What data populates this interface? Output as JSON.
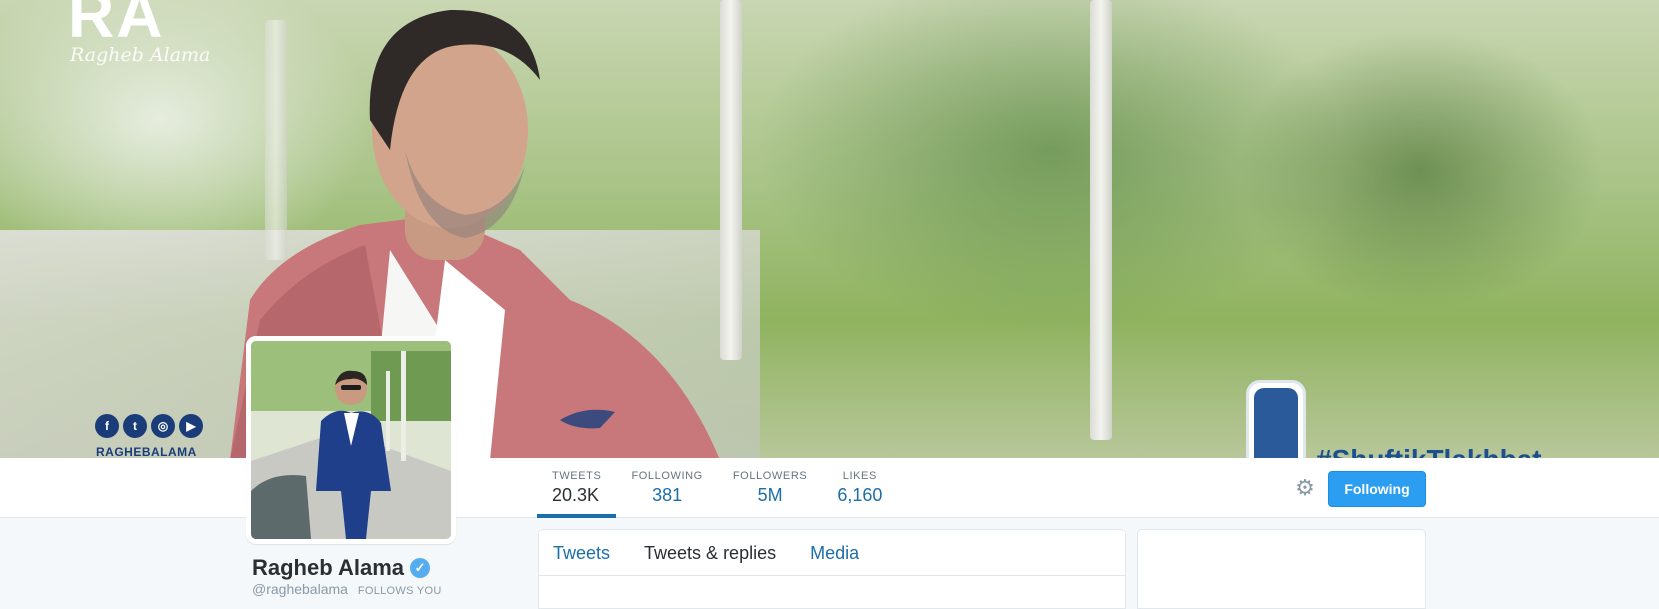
{
  "banner": {
    "logo_text": "RA",
    "signature": "Ragheb Alama",
    "social_handle": "RAGHEBALAMA",
    "social_icons": [
      "facebook-icon",
      "twitter-icon",
      "instagram-icon",
      "youtube-icon"
    ],
    "hashtag": "#ShuftikTlakhbat"
  },
  "profile": {
    "name": "Ragheb Alama",
    "handle": "@raghebalama",
    "follows_you": "FOLLOWS YOU",
    "verified": true
  },
  "stats": [
    {
      "label": "TWEETS",
      "value": "20.3K",
      "active": true
    },
    {
      "label": "FOLLOWING",
      "value": "381"
    },
    {
      "label": "FOLLOWERS",
      "value": "5M"
    },
    {
      "label": "LIKES",
      "value": "6,160"
    }
  ],
  "actions": {
    "follow_label": "Following"
  },
  "tabs": [
    {
      "label": "Tweets"
    },
    {
      "label": "Tweets & replies"
    },
    {
      "label": "Media"
    }
  ],
  "colors": {
    "accent": "#1b6ea8",
    "button": "#2b9ef1",
    "verified": "#55acee"
  }
}
